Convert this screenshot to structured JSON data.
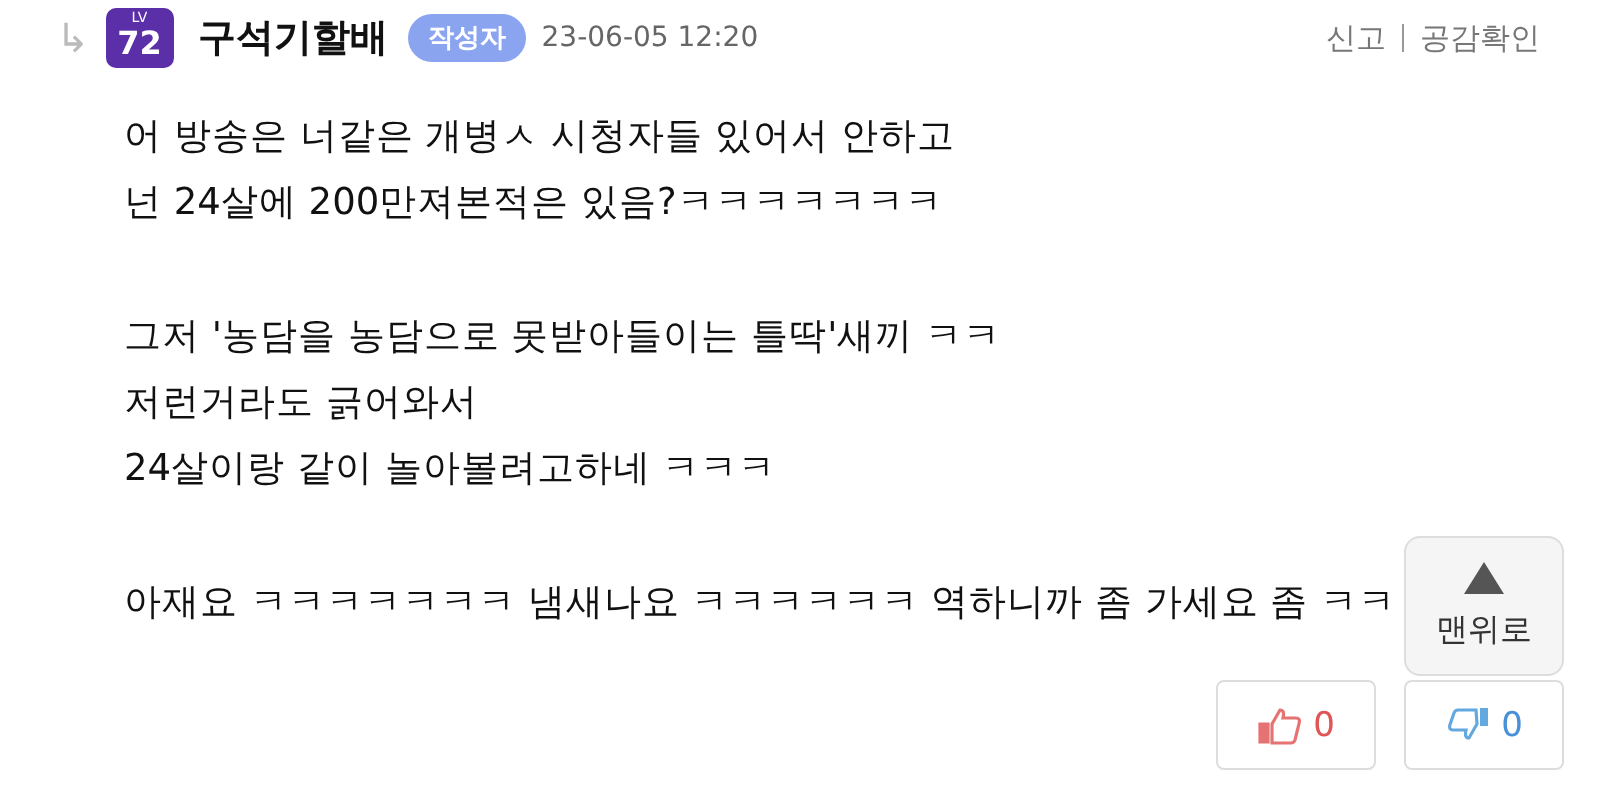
{
  "reply_arrow": "↳",
  "author": {
    "level": "72",
    "level_tag": "LV",
    "name": "구석기할배",
    "badge": "작성자",
    "time": "23-06-05 12:20"
  },
  "actions": [
    {
      "label": "신고"
    },
    {
      "label": "공감확인"
    }
  ],
  "paragraphs": [
    [
      "어 방송은 너같은 개병ㅅ 시청자들 있어서 안하고",
      "넌 24살에 200만져본적은 있음?ㅋㅋㅋㅋㅋㅋㅋ"
    ],
    [
      "그저 '농담을 농담으로 못받아들이는 틀딱'새끼 ㅋㅋ",
      "저런거라도 긁어와서",
      "24살이랑 같이 놀아볼려고하네 ㅋㅋㅋ"
    ],
    [
      "아재요 ㅋㅋㅋㅋㅋㅋㅋ 냄새나요 ㅋㅋㅋㅋㅋㅋ 역하니까 좀 가세요 좀 ㅋㅋ"
    ]
  ],
  "votes": [
    {
      "kind": "up",
      "count": "0"
    },
    {
      "kind": "down",
      "count": "0"
    }
  ],
  "scroll_top": {
    "label": "맨위로"
  }
}
